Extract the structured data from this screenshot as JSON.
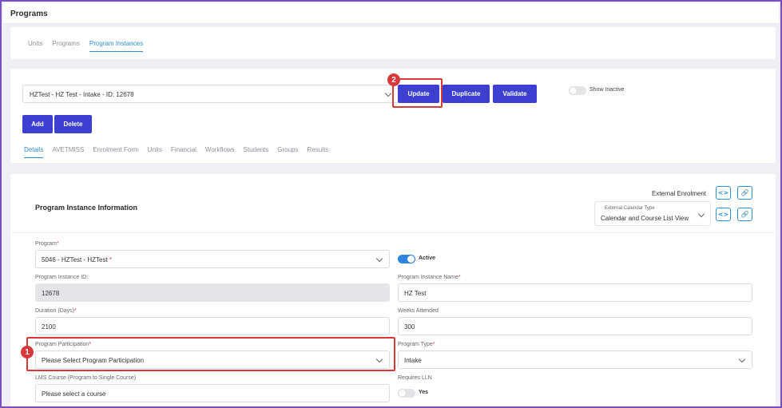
{
  "page": {
    "title": "Programs"
  },
  "tabs": [
    "Units",
    "Programs",
    "Program Instances"
  ],
  "active_tab": "Program Instances",
  "instance_selector": {
    "value": "HZTest - HZ Test - Intake - ID: 12678"
  },
  "buttons": {
    "update": "Update",
    "duplicate": "Duplicate",
    "validate": "Validate",
    "add": "Add",
    "delete": "Delete"
  },
  "show_inactive": {
    "label": "Show Inactive",
    "on": false
  },
  "sub_tabs": [
    "Details",
    "AVETMISS",
    "Enrolment Form",
    "Units",
    "Financial",
    "Workflows",
    "Students",
    "Groups",
    "Results"
  ],
  "active_sub_tab": "Details",
  "info": {
    "title": "Program Instance Information",
    "external_enrolment_label": "External Enrolment",
    "external_calendar": {
      "caption": "External Calendar Type",
      "value": "Calendar and Course List View"
    },
    "fields": {
      "program": {
        "label": "Program",
        "value": "5046 - HZTest - HZTest"
      },
      "active": {
        "label": "Active",
        "on": true
      },
      "instance_id": {
        "label": "Program Instance ID:",
        "value": "12678"
      },
      "instance_name": {
        "label": "Program Instance Name",
        "value": "HZ Test"
      },
      "duration": {
        "label": "Duration (Days)",
        "value": "2100"
      },
      "weeks_attended": {
        "label": "Weeks Attended",
        "value": "300"
      },
      "participation": {
        "label": "Program Participation",
        "value": "Please Select Program Participation"
      },
      "program_type": {
        "label": "Program Type",
        "value": "Intake"
      },
      "lms_course": {
        "label": "LMS Course (Program to Single Course)",
        "value": "Please select a course"
      },
      "requires_lln": {
        "label": "Requires LLN",
        "value": "Yes",
        "on": false
      }
    },
    "required_mark": "*"
  },
  "annotations": {
    "badge_1": "1",
    "badge_2": "2"
  },
  "colors": {
    "primary_button": "#3d3fd1",
    "accent": "#2d8fd0",
    "highlight": "#d9373a",
    "frame": "#7b4ec2"
  }
}
